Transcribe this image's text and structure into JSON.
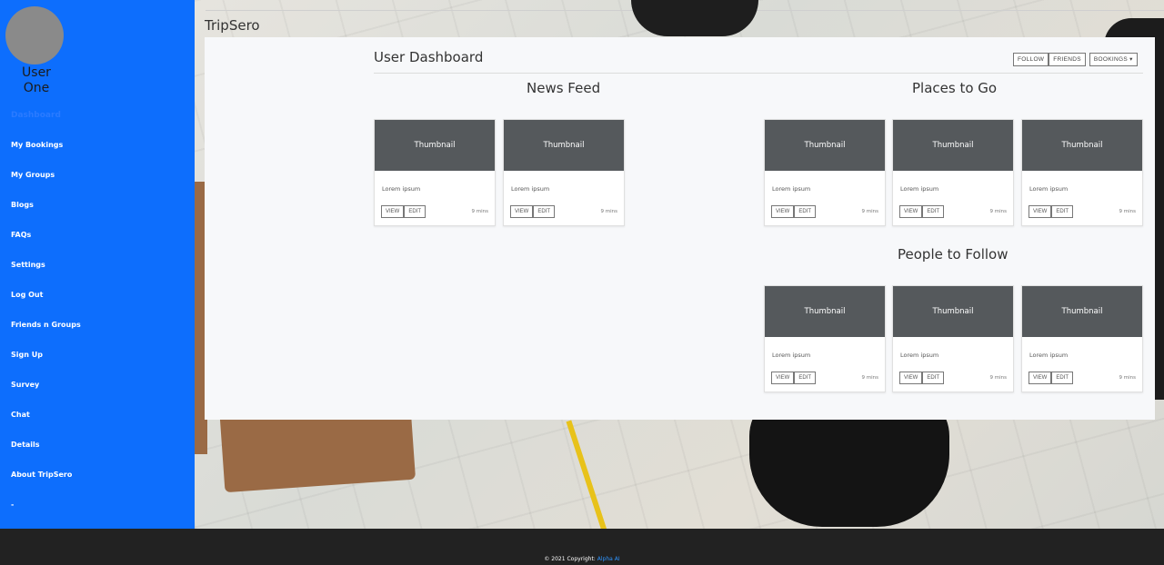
{
  "sidebar": {
    "user_name_line1": "User",
    "user_name_line2": "One",
    "section_label": "Dashboard",
    "items": [
      {
        "label": "My Bookings"
      },
      {
        "label": "My Groups"
      },
      {
        "label": "Blogs"
      },
      {
        "label": "FAQs"
      },
      {
        "label": "Settings"
      },
      {
        "label": "Log Out"
      },
      {
        "label": "Friends n Groups"
      },
      {
        "label": "Sign Up"
      },
      {
        "label": "Survey"
      },
      {
        "label": "Chat"
      },
      {
        "label": "Details"
      },
      {
        "label": "About TripSero"
      },
      {
        "label": "-"
      }
    ]
  },
  "header": {
    "brand": "TripSero"
  },
  "dashboard": {
    "title": "User Dashboard",
    "buttons": {
      "follow": "FOLLOW",
      "friends": "FRIENDS",
      "bookings": "BOOKINGS ▾"
    },
    "sections": {
      "news_feed": "News Feed",
      "places": "Places to Go",
      "people": "People to Follow"
    },
    "card": {
      "thumbnail": "Thumbnail",
      "text": "Lorem ipsum",
      "view": "VIEW",
      "edit": "EDIT",
      "time": "9 mins"
    }
  },
  "footer": {
    "copyright": "© 2021 Copyright:",
    "link": "Alpha AI"
  },
  "colors": {
    "sidebar": "#0d6efd",
    "thumbnail": "#55595c",
    "footer": "#222222",
    "link": "#2f95ff"
  }
}
